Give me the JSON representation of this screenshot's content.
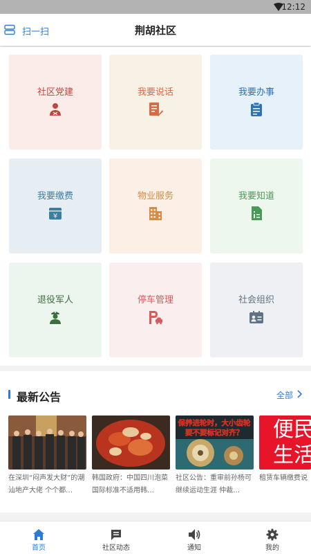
{
  "status_bar": {
    "time": "12:12"
  },
  "header": {
    "scan_label": "扫一扫",
    "title": "荆胡社区"
  },
  "tiles": [
    {
      "label": "社区党建",
      "icon": "party-member-icon",
      "bg": "#fbecea",
      "color": "#c4453c"
    },
    {
      "label": "我要说话",
      "icon": "edit-document-icon",
      "bg": "#f8f1e6",
      "color": "#d96a43"
    },
    {
      "label": "我要办事",
      "icon": "clipboard-icon",
      "bg": "#e6f1f9",
      "color": "#2b72b9"
    },
    {
      "label": "我要缴费",
      "icon": "payment-icon",
      "bg": "#e7eef3",
      "color": "#3a7f9e"
    },
    {
      "label": "物业服务",
      "icon": "building-icon",
      "bg": "#fcefe5",
      "color": "#d98a44"
    },
    {
      "label": "我要知道",
      "icon": "info-document-icon",
      "bg": "#edf7ee",
      "color": "#4a9a57"
    },
    {
      "label": "退役军人",
      "icon": "soldier-icon",
      "bg": "#ecf6ee",
      "color": "#3c6e3f"
    },
    {
      "label": "停车管理",
      "icon": "parking-icon",
      "bg": "#fbeeee",
      "color": "#d95a5a"
    },
    {
      "label": "社会组织",
      "icon": "id-card-icon",
      "bg": "#eef0f4",
      "color": "#5f7385"
    }
  ],
  "announcements": {
    "title": "最新公告",
    "all_label": "全部",
    "items": [
      {
        "text": "在深圳“闷声发大财”的潮汕地产大佬 个个都…"
      },
      {
        "text": "韩国政府：中国四川泡菜国际标准不适用韩…"
      },
      {
        "text": "社区公告：重审前孙杨可继续运动生涯 仲裁…",
        "banner_line1": "保养进轮时，大小齿轮",
        "banner_line2": "要不要标记对齐？"
      },
      {
        "text": "租赁车辆缴费说",
        "banner_line1": "便民",
        "banner_line2": "生活"
      }
    ]
  },
  "tab_bar": {
    "active": 0,
    "tabs": [
      {
        "label": "首页",
        "icon": "home-icon"
      },
      {
        "label": "社区动态",
        "icon": "message-icon"
      },
      {
        "label": "通知",
        "icon": "speaker-icon"
      },
      {
        "label": "我的",
        "icon": "gear-icon"
      }
    ]
  }
}
